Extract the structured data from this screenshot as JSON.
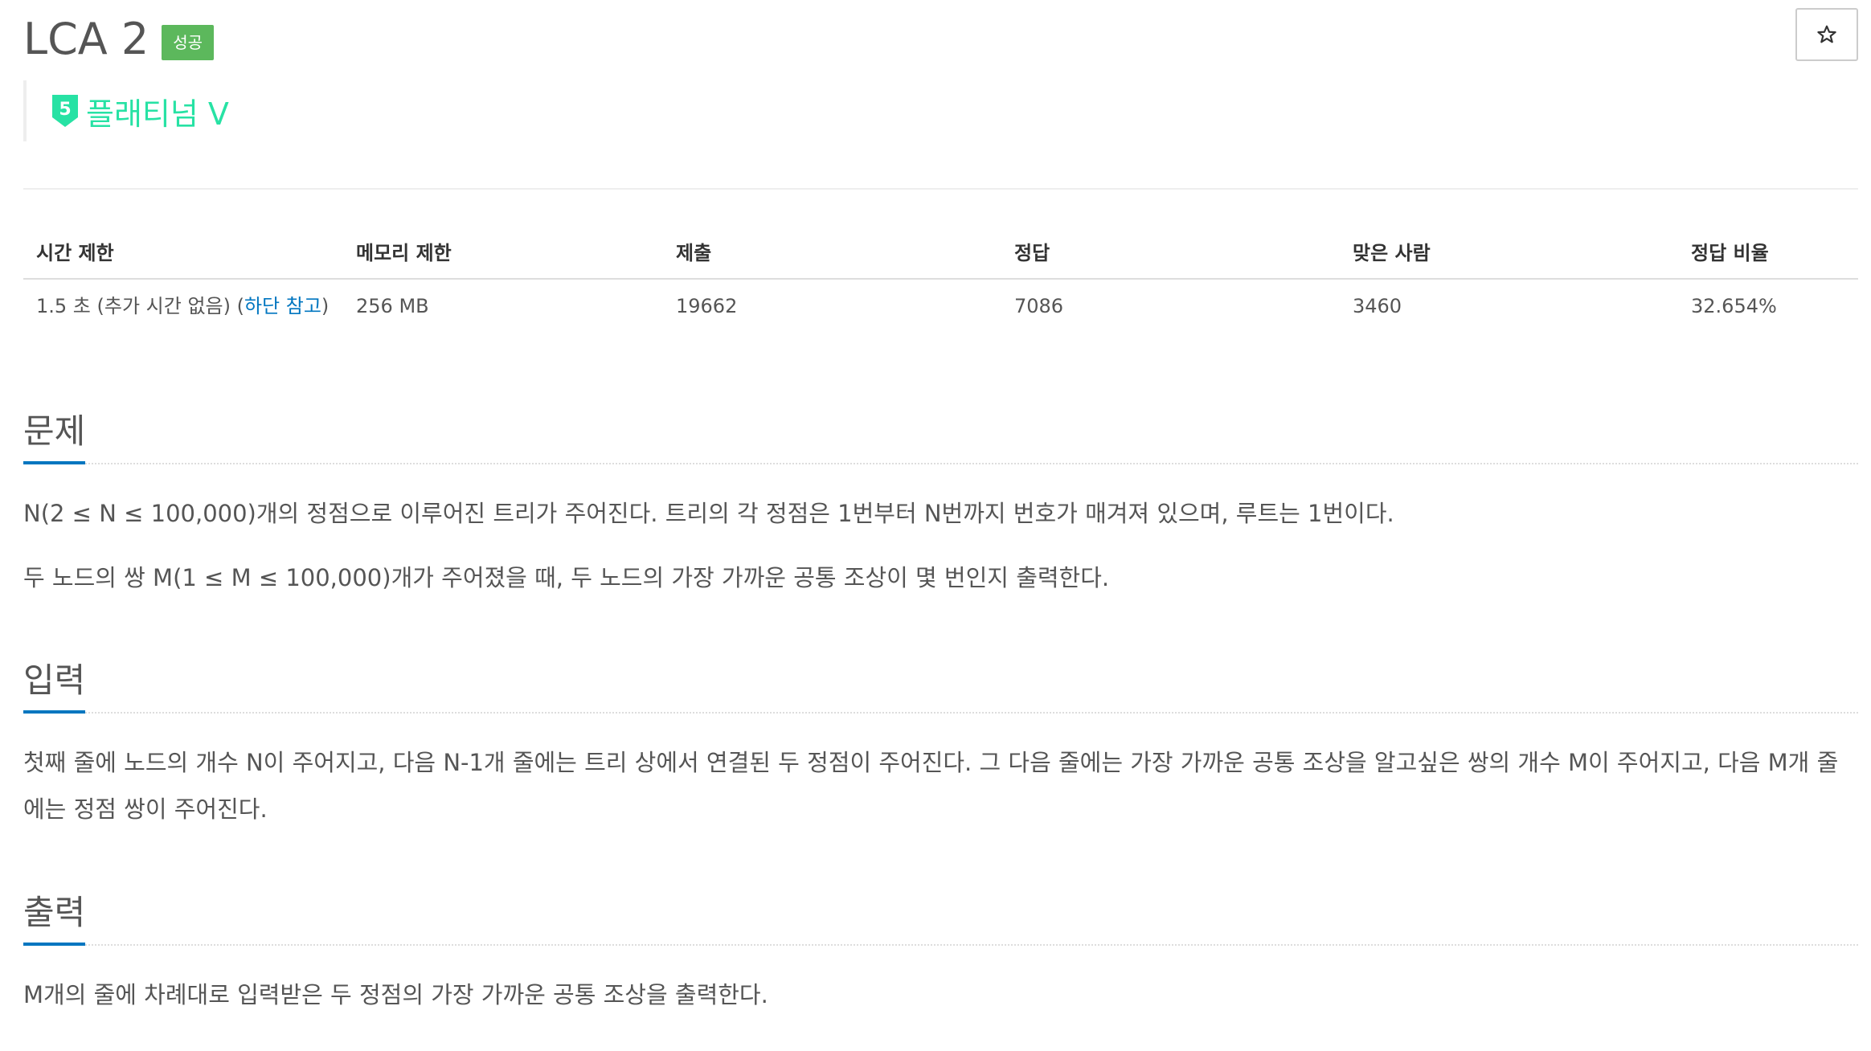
{
  "problem": {
    "title": "LCA 2",
    "status_badge": "성공",
    "tier": "플래티넘 V",
    "tier_level": "5",
    "tier_color": "#27e2a4"
  },
  "star_icon": "star-outline-icon",
  "stats": {
    "headers": [
      "시간 제한",
      "메모리 제한",
      "제출",
      "정답",
      "맞은 사람",
      "정답 비율"
    ],
    "time_limit_prefix": "1.5 초 (추가 시간 없음) (",
    "time_limit_link": "하단 참고",
    "time_limit_suffix": ")",
    "memory_limit": "256 MB",
    "submissions": "19662",
    "accepted": "7086",
    "solvers": "3460",
    "ratio": "32.654%"
  },
  "sections": {
    "problem": {
      "title": "문제",
      "paragraphs": [
        "N(2 ≤ N ≤ 100,000)개의 정점으로 이루어진 트리가 주어진다. 트리의 각 정점은 1번부터 N번까지 번호가 매겨져 있으며, 루트는 1번이다.",
        "두 노드의 쌍 M(1 ≤ M ≤ 100,000)개가 주어졌을 때, 두 노드의 가장 가까운 공통 조상이 몇 번인지 출력한다."
      ]
    },
    "input": {
      "title": "입력",
      "text": "첫째 줄에 노드의 개수 N이 주어지고, 다음 N-1개 줄에는 트리 상에서 연결된 두 정점이 주어진다. 그 다음 줄에는 가장 가까운 공통 조상을 알고싶은 쌍의 개수 M이 주어지고, 다음 M개 줄에는 정점 쌍이 주어진다."
    },
    "output": {
      "title": "출력",
      "text": "M개의 줄에 차례대로 입력받은 두 정점의 가장 가까운 공통 조상을 출력한다."
    }
  },
  "colors": {
    "accent": "#0076c0",
    "success": "#5cb85c",
    "platinum": "#27e2a4"
  }
}
